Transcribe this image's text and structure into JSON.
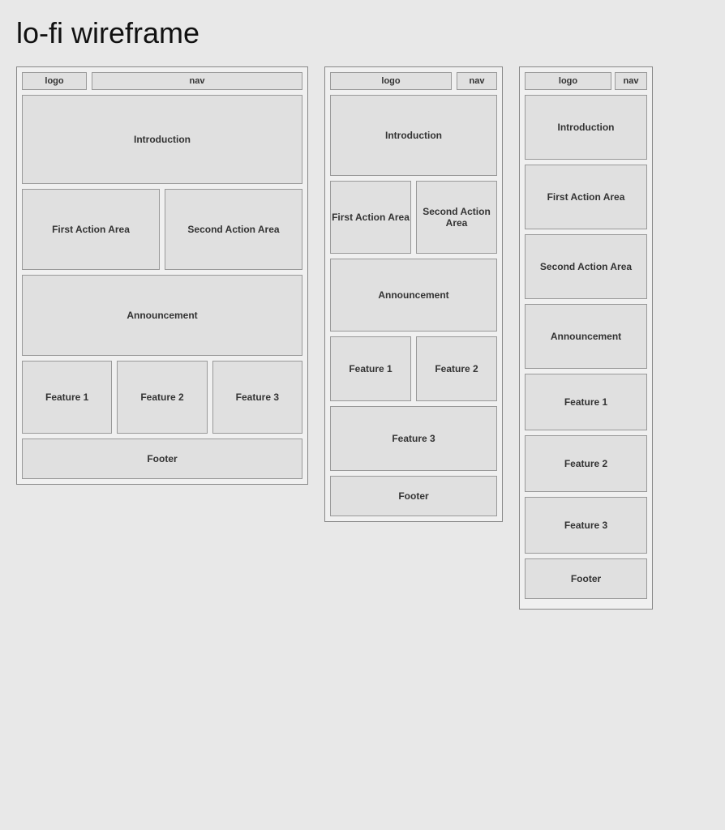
{
  "page": {
    "title": "lo-fi wireframe"
  },
  "frame1": {
    "nav": {
      "logo": "logo",
      "nav": "nav"
    },
    "intro": "Introduction",
    "first_action": "First Action Area",
    "second_action": "Second Action Area",
    "announcement": "Announcement",
    "feature1": "Feature 1",
    "feature2": "Feature 2",
    "feature3": "Feature 3",
    "footer": "Footer"
  },
  "frame2": {
    "nav": {
      "logo": "logo",
      "nav": "nav"
    },
    "intro": "Introduction",
    "first_action": "First Action Area",
    "second_action": "Second Action Area",
    "announcement": "Announcement",
    "feature1": "Feature 1",
    "feature2": "Feature 2",
    "feature3": "Feature 3",
    "footer": "Footer"
  },
  "frame3": {
    "nav": {
      "logo": "logo",
      "nav": "nav"
    },
    "intro": "Introduction",
    "first_action": "First Action Area",
    "second_action": "Second Action Area",
    "announcement": "Announcement",
    "feature1": "Feature 1",
    "feature2": "Feature 2",
    "feature3": "Feature 3",
    "footer": "Footer"
  }
}
